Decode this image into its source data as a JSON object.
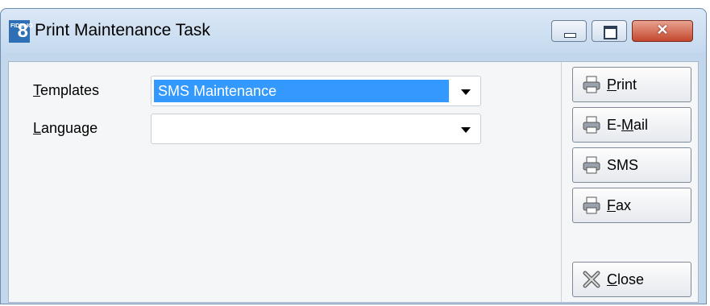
{
  "window": {
    "title": "Print Maintenance Task",
    "app_icon": "8",
    "app_icon_small": "FIDELIO"
  },
  "titlebar_buttons": {
    "minimize": "minimize-icon",
    "maximize": "maximize-icon",
    "close": "✕"
  },
  "form": {
    "templates": {
      "mnemonic": "T",
      "rest": "emplates",
      "value": "SMS Maintenance"
    },
    "language": {
      "mnemonic": "L",
      "rest": "anguage",
      "value": ""
    }
  },
  "buttons": {
    "print": {
      "pre": "",
      "mnemonic": "P",
      "post": "rint",
      "icon": "printer-icon"
    },
    "email": {
      "pre": "E-",
      "mnemonic": "M",
      "post": "ail",
      "icon": "printer-icon"
    },
    "sms": {
      "pre": "SMS",
      "mnemonic": "",
      "post": "",
      "icon": "printer-icon"
    },
    "fax": {
      "pre": "",
      "mnemonic": "F",
      "post": "ax",
      "icon": "printer-icon"
    },
    "close": {
      "pre": "",
      "mnemonic": "C",
      "post": "lose",
      "icon": "close-x-icon"
    }
  }
}
